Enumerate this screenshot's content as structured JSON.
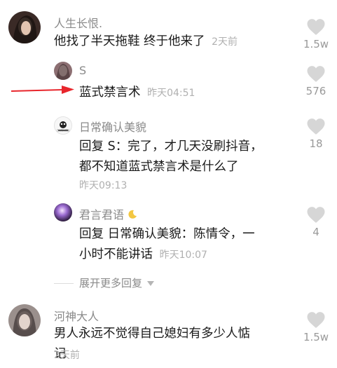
{
  "comments": [
    {
      "username": "人生长恨.",
      "text": "他找了半天拖鞋 终于他来了",
      "time": "2天前",
      "likes": "1.5w"
    },
    {
      "username": "S",
      "text": "蓝式禁言术",
      "time": "昨天04:51",
      "likes": "576"
    },
    {
      "username": "日常确认美貌",
      "avatar_caption": "日常确认美貌",
      "reply_prefix": "回复 ",
      "reply_to": "S",
      "text_line1": "：完了，才几天没刷抖音，",
      "text_line2": "都不知道蓝式禁言术是什么了",
      "time": "昨天09:13",
      "likes": "18"
    },
    {
      "username": "君言君语",
      "reply_prefix": "回复 ",
      "reply_to": "日常确认美貌",
      "text_line1": "：陈情令，一",
      "text_line2": "小时不能讲话",
      "time": "昨天10:07",
      "likes": "4"
    },
    {
      "username": "河神大人",
      "text_line1": "男人永远不觉得自己媳妇有多少人惦",
      "text_line2": "记",
      "time": "2天前",
      "likes": "1.5w"
    }
  ],
  "expand_replies_label": "展开更多回复",
  "colors": {
    "annotation_arrow": "#e8262c",
    "like_icon": "#d6d6d6",
    "username": "#8a8a8a",
    "timestamp": "#b0b0b0"
  },
  "icons": [
    "heart-icon",
    "moon-icon",
    "chevron-down-icon",
    "arrow-annotation"
  ]
}
